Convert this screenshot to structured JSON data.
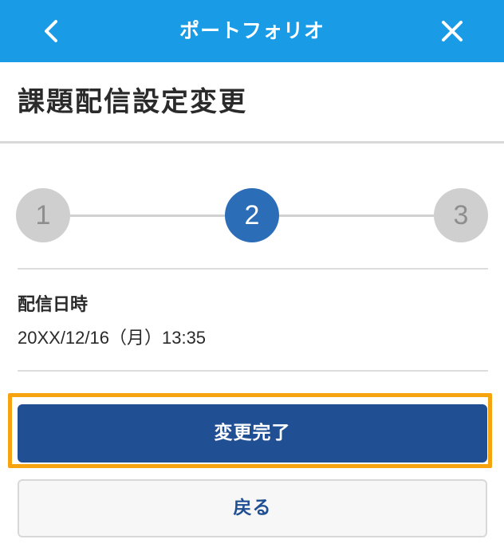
{
  "header": {
    "title": "ポートフォリオ",
    "back_icon": "chevron-left-icon",
    "close_icon": "close-icon",
    "background_color": "#1a9be6"
  },
  "page": {
    "title": "課題配信設定変更"
  },
  "stepper": {
    "steps": [
      "1",
      "2",
      "3"
    ],
    "current_step": 2,
    "active_color": "#2c6db7",
    "inactive_color": "#cfcfcf"
  },
  "delivery": {
    "label": "配信日時",
    "value": "20XX/12/16（月）13:35"
  },
  "actions": {
    "confirm_label": "変更完了",
    "back_label": "戻る",
    "primary_color": "#214f93",
    "highlight_color": "#f5a30f"
  }
}
